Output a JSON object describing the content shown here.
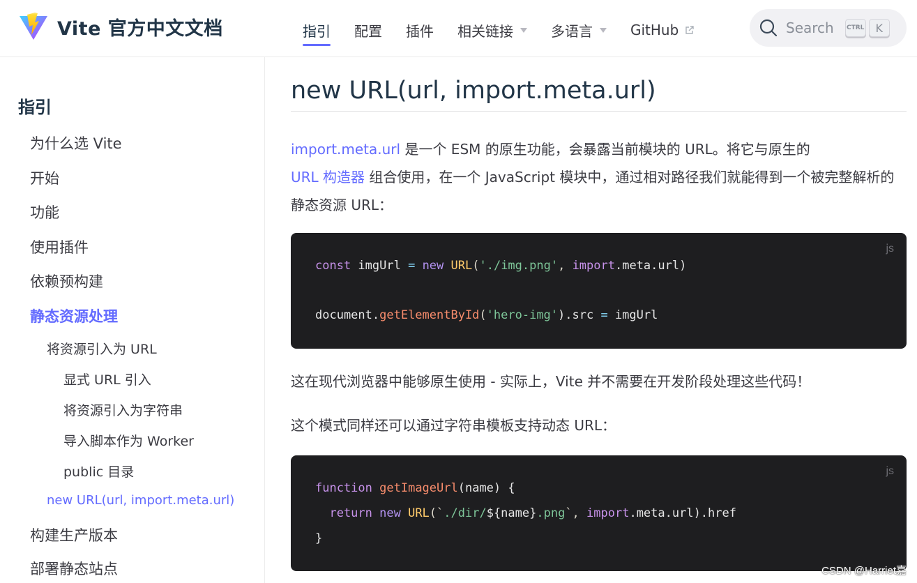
{
  "navbar": {
    "brand_title": "Vite 官方中文文档",
    "links": [
      {
        "label": "指引",
        "active": true
      },
      {
        "label": "配置"
      },
      {
        "label": "插件"
      },
      {
        "label": "相关链接",
        "dropdown": true
      },
      {
        "label": "多语言",
        "dropdown": true
      },
      {
        "label": "GitHub",
        "external": true
      }
    ],
    "search": {
      "placeholder": "Search",
      "shortcut_ctrl": "CTRL",
      "shortcut_key": "K"
    }
  },
  "sidebar": {
    "heading": "指引",
    "items": [
      {
        "label": "为什么选 Vite"
      },
      {
        "label": "开始"
      },
      {
        "label": "功能"
      },
      {
        "label": "使用插件"
      },
      {
        "label": "依赖预构建"
      },
      {
        "label": "静态资源处理",
        "active": true
      },
      {
        "label": "将资源引入为 URL"
      },
      {
        "label": "显式 URL 引入"
      },
      {
        "label": "将资源引入为字符串"
      },
      {
        "label": "导入脚本作为 Worker"
      },
      {
        "label": "public 目录"
      },
      {
        "label": "new URL(url, import.meta.url)",
        "current": true
      },
      {
        "label": "构建生产版本"
      },
      {
        "label": "部署静态站点"
      }
    ]
  },
  "content": {
    "title": "new URL(url, import.meta.url)",
    "para1": {
      "link1": "import.meta.url",
      "text1": " 是一个 ESM 的原生功能，会暴露当前模块的 URL。将它与原生的",
      "link2": "URL 构造器",
      "text2": " 组合使用，在一个 JavaScript 模块中，通过相对路径我们就能得到一个被完整解析的静态资源 URL："
    },
    "code1": {
      "lang": "js",
      "line1": {
        "t1": "const",
        "t2": " imgUrl ",
        "t3": "=",
        "t4": " new ",
        "t5": "URL",
        "t6": "(",
        "t7": "'./img.png'",
        "t8": ", ",
        "t9": "import",
        "t10": ".meta.url)"
      },
      "line2": {
        "t1": "document.",
        "t2": "getElementById",
        "t3": "(",
        "t4": "'hero-img'",
        "t5": ").src ",
        "t6": "=",
        "t7": " imgUrl"
      }
    },
    "para2": "这在现代浏览器中能够原生使用 - 实际上，Vite 并不需要在开发阶段处理这些代码！",
    "para3": "这个模式同样还可以通过字符串模板支持动态 URL：",
    "code2": {
      "lang": "js",
      "line1": {
        "t1": "function",
        "t2": " ",
        "t3": "getImageUrl",
        "t4": "(name) {"
      },
      "line2": {
        "t1": "  return",
        "t2": " new ",
        "t3": "URL",
        "t4": "(`",
        "t5": "./dir/",
        "t6": "${name}",
        "t7": ".png",
        "t8": "`, ",
        "t9": "import",
        "t10": ".meta.url).href"
      },
      "line3": {
        "t1": "}"
      }
    }
  },
  "watermark": "CSDN @Harriet嘉"
}
